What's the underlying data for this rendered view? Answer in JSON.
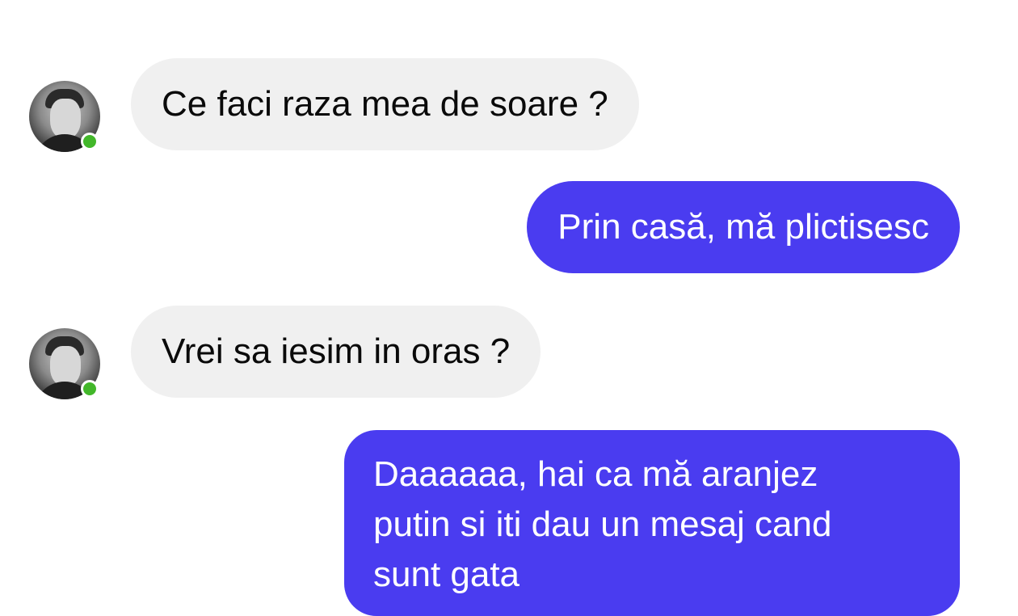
{
  "messages": [
    {
      "direction": "incoming",
      "text": "Ce faci raza mea de soare ?",
      "online": true
    },
    {
      "direction": "outgoing",
      "text": "Prin casă, mă plictisesc"
    },
    {
      "direction": "incoming",
      "text": "Vrei sa iesim in oras ?",
      "online": true
    },
    {
      "direction": "outgoing",
      "lines": [
        "Daaaaaa, hai ca mă aranjez",
        "putin si iti dau un mesaj cand",
        "sunt gata"
      ]
    }
  ],
  "colors": {
    "incoming_bubble": "#f0f0f0",
    "outgoing_bubble": "#4a3cf0",
    "online_indicator": "#42b72a"
  }
}
